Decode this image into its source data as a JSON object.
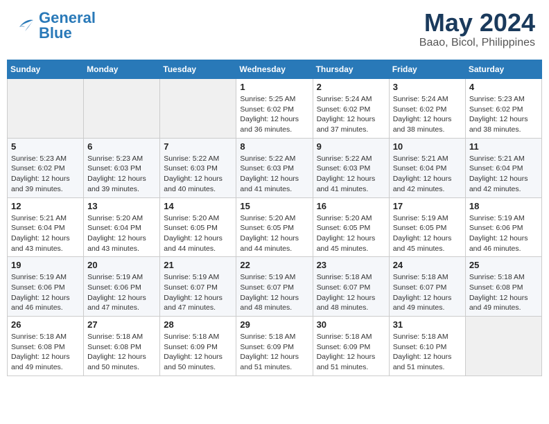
{
  "header": {
    "logo_general": "General",
    "logo_blue": "Blue",
    "month_title": "May 2024",
    "location": "Baao, Bicol, Philippines"
  },
  "weekdays": [
    "Sunday",
    "Monday",
    "Tuesday",
    "Wednesday",
    "Thursday",
    "Friday",
    "Saturday"
  ],
  "weeks": [
    [
      {
        "day": "",
        "info": ""
      },
      {
        "day": "",
        "info": ""
      },
      {
        "day": "",
        "info": ""
      },
      {
        "day": "1",
        "info": "Sunrise: 5:25 AM\nSunset: 6:02 PM\nDaylight: 12 hours\nand 36 minutes."
      },
      {
        "day": "2",
        "info": "Sunrise: 5:24 AM\nSunset: 6:02 PM\nDaylight: 12 hours\nand 37 minutes."
      },
      {
        "day": "3",
        "info": "Sunrise: 5:24 AM\nSunset: 6:02 PM\nDaylight: 12 hours\nand 38 minutes."
      },
      {
        "day": "4",
        "info": "Sunrise: 5:23 AM\nSunset: 6:02 PM\nDaylight: 12 hours\nand 38 minutes."
      }
    ],
    [
      {
        "day": "5",
        "info": "Sunrise: 5:23 AM\nSunset: 6:02 PM\nDaylight: 12 hours\nand 39 minutes."
      },
      {
        "day": "6",
        "info": "Sunrise: 5:23 AM\nSunset: 6:03 PM\nDaylight: 12 hours\nand 39 minutes."
      },
      {
        "day": "7",
        "info": "Sunrise: 5:22 AM\nSunset: 6:03 PM\nDaylight: 12 hours\nand 40 minutes."
      },
      {
        "day": "8",
        "info": "Sunrise: 5:22 AM\nSunset: 6:03 PM\nDaylight: 12 hours\nand 41 minutes."
      },
      {
        "day": "9",
        "info": "Sunrise: 5:22 AM\nSunset: 6:03 PM\nDaylight: 12 hours\nand 41 minutes."
      },
      {
        "day": "10",
        "info": "Sunrise: 5:21 AM\nSunset: 6:04 PM\nDaylight: 12 hours\nand 42 minutes."
      },
      {
        "day": "11",
        "info": "Sunrise: 5:21 AM\nSunset: 6:04 PM\nDaylight: 12 hours\nand 42 minutes."
      }
    ],
    [
      {
        "day": "12",
        "info": "Sunrise: 5:21 AM\nSunset: 6:04 PM\nDaylight: 12 hours\nand 43 minutes."
      },
      {
        "day": "13",
        "info": "Sunrise: 5:20 AM\nSunset: 6:04 PM\nDaylight: 12 hours\nand 43 minutes."
      },
      {
        "day": "14",
        "info": "Sunrise: 5:20 AM\nSunset: 6:05 PM\nDaylight: 12 hours\nand 44 minutes."
      },
      {
        "day": "15",
        "info": "Sunrise: 5:20 AM\nSunset: 6:05 PM\nDaylight: 12 hours\nand 44 minutes."
      },
      {
        "day": "16",
        "info": "Sunrise: 5:20 AM\nSunset: 6:05 PM\nDaylight: 12 hours\nand 45 minutes."
      },
      {
        "day": "17",
        "info": "Sunrise: 5:19 AM\nSunset: 6:05 PM\nDaylight: 12 hours\nand 45 minutes."
      },
      {
        "day": "18",
        "info": "Sunrise: 5:19 AM\nSunset: 6:06 PM\nDaylight: 12 hours\nand 46 minutes."
      }
    ],
    [
      {
        "day": "19",
        "info": "Sunrise: 5:19 AM\nSunset: 6:06 PM\nDaylight: 12 hours\nand 46 minutes."
      },
      {
        "day": "20",
        "info": "Sunrise: 5:19 AM\nSunset: 6:06 PM\nDaylight: 12 hours\nand 47 minutes."
      },
      {
        "day": "21",
        "info": "Sunrise: 5:19 AM\nSunset: 6:07 PM\nDaylight: 12 hours\nand 47 minutes."
      },
      {
        "day": "22",
        "info": "Sunrise: 5:19 AM\nSunset: 6:07 PM\nDaylight: 12 hours\nand 48 minutes."
      },
      {
        "day": "23",
        "info": "Sunrise: 5:18 AM\nSunset: 6:07 PM\nDaylight: 12 hours\nand 48 minutes."
      },
      {
        "day": "24",
        "info": "Sunrise: 5:18 AM\nSunset: 6:07 PM\nDaylight: 12 hours\nand 49 minutes."
      },
      {
        "day": "25",
        "info": "Sunrise: 5:18 AM\nSunset: 6:08 PM\nDaylight: 12 hours\nand 49 minutes."
      }
    ],
    [
      {
        "day": "26",
        "info": "Sunrise: 5:18 AM\nSunset: 6:08 PM\nDaylight: 12 hours\nand 49 minutes."
      },
      {
        "day": "27",
        "info": "Sunrise: 5:18 AM\nSunset: 6:08 PM\nDaylight: 12 hours\nand 50 minutes."
      },
      {
        "day": "28",
        "info": "Sunrise: 5:18 AM\nSunset: 6:09 PM\nDaylight: 12 hours\nand 50 minutes."
      },
      {
        "day": "29",
        "info": "Sunrise: 5:18 AM\nSunset: 6:09 PM\nDaylight: 12 hours\nand 51 minutes."
      },
      {
        "day": "30",
        "info": "Sunrise: 5:18 AM\nSunset: 6:09 PM\nDaylight: 12 hours\nand 51 minutes."
      },
      {
        "day": "31",
        "info": "Sunrise: 5:18 AM\nSunset: 6:10 PM\nDaylight: 12 hours\nand 51 minutes."
      },
      {
        "day": "",
        "info": ""
      }
    ]
  ]
}
